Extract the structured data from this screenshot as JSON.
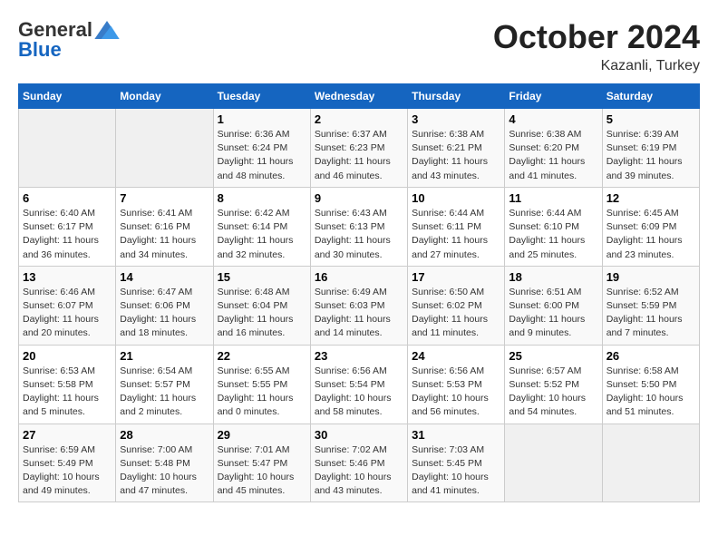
{
  "header": {
    "logo_general": "General",
    "logo_blue": "Blue",
    "month_title": "October 2024",
    "location": "Kazanli, Turkey"
  },
  "days_of_week": [
    "Sunday",
    "Monday",
    "Tuesday",
    "Wednesday",
    "Thursday",
    "Friday",
    "Saturday"
  ],
  "weeks": [
    [
      {
        "day": null
      },
      {
        "day": null
      },
      {
        "day": "1",
        "sunrise": "Sunrise: 6:36 AM",
        "sunset": "Sunset: 6:24 PM",
        "daylight": "Daylight: 11 hours and 48 minutes."
      },
      {
        "day": "2",
        "sunrise": "Sunrise: 6:37 AM",
        "sunset": "Sunset: 6:23 PM",
        "daylight": "Daylight: 11 hours and 46 minutes."
      },
      {
        "day": "3",
        "sunrise": "Sunrise: 6:38 AM",
        "sunset": "Sunset: 6:21 PM",
        "daylight": "Daylight: 11 hours and 43 minutes."
      },
      {
        "day": "4",
        "sunrise": "Sunrise: 6:38 AM",
        "sunset": "Sunset: 6:20 PM",
        "daylight": "Daylight: 11 hours and 41 minutes."
      },
      {
        "day": "5",
        "sunrise": "Sunrise: 6:39 AM",
        "sunset": "Sunset: 6:19 PM",
        "daylight": "Daylight: 11 hours and 39 minutes."
      }
    ],
    [
      {
        "day": "6",
        "sunrise": "Sunrise: 6:40 AM",
        "sunset": "Sunset: 6:17 PM",
        "daylight": "Daylight: 11 hours and 36 minutes."
      },
      {
        "day": "7",
        "sunrise": "Sunrise: 6:41 AM",
        "sunset": "Sunset: 6:16 PM",
        "daylight": "Daylight: 11 hours and 34 minutes."
      },
      {
        "day": "8",
        "sunrise": "Sunrise: 6:42 AM",
        "sunset": "Sunset: 6:14 PM",
        "daylight": "Daylight: 11 hours and 32 minutes."
      },
      {
        "day": "9",
        "sunrise": "Sunrise: 6:43 AM",
        "sunset": "Sunset: 6:13 PM",
        "daylight": "Daylight: 11 hours and 30 minutes."
      },
      {
        "day": "10",
        "sunrise": "Sunrise: 6:44 AM",
        "sunset": "Sunset: 6:11 PM",
        "daylight": "Daylight: 11 hours and 27 minutes."
      },
      {
        "day": "11",
        "sunrise": "Sunrise: 6:44 AM",
        "sunset": "Sunset: 6:10 PM",
        "daylight": "Daylight: 11 hours and 25 minutes."
      },
      {
        "day": "12",
        "sunrise": "Sunrise: 6:45 AM",
        "sunset": "Sunset: 6:09 PM",
        "daylight": "Daylight: 11 hours and 23 minutes."
      }
    ],
    [
      {
        "day": "13",
        "sunrise": "Sunrise: 6:46 AM",
        "sunset": "Sunset: 6:07 PM",
        "daylight": "Daylight: 11 hours and 20 minutes."
      },
      {
        "day": "14",
        "sunrise": "Sunrise: 6:47 AM",
        "sunset": "Sunset: 6:06 PM",
        "daylight": "Daylight: 11 hours and 18 minutes."
      },
      {
        "day": "15",
        "sunrise": "Sunrise: 6:48 AM",
        "sunset": "Sunset: 6:04 PM",
        "daylight": "Daylight: 11 hours and 16 minutes."
      },
      {
        "day": "16",
        "sunrise": "Sunrise: 6:49 AM",
        "sunset": "Sunset: 6:03 PM",
        "daylight": "Daylight: 11 hours and 14 minutes."
      },
      {
        "day": "17",
        "sunrise": "Sunrise: 6:50 AM",
        "sunset": "Sunset: 6:02 PM",
        "daylight": "Daylight: 11 hours and 11 minutes."
      },
      {
        "day": "18",
        "sunrise": "Sunrise: 6:51 AM",
        "sunset": "Sunset: 6:00 PM",
        "daylight": "Daylight: 11 hours and 9 minutes."
      },
      {
        "day": "19",
        "sunrise": "Sunrise: 6:52 AM",
        "sunset": "Sunset: 5:59 PM",
        "daylight": "Daylight: 11 hours and 7 minutes."
      }
    ],
    [
      {
        "day": "20",
        "sunrise": "Sunrise: 6:53 AM",
        "sunset": "Sunset: 5:58 PM",
        "daylight": "Daylight: 11 hours and 5 minutes."
      },
      {
        "day": "21",
        "sunrise": "Sunrise: 6:54 AM",
        "sunset": "Sunset: 5:57 PM",
        "daylight": "Daylight: 11 hours and 2 minutes."
      },
      {
        "day": "22",
        "sunrise": "Sunrise: 6:55 AM",
        "sunset": "Sunset: 5:55 PM",
        "daylight": "Daylight: 11 hours and 0 minutes."
      },
      {
        "day": "23",
        "sunrise": "Sunrise: 6:56 AM",
        "sunset": "Sunset: 5:54 PM",
        "daylight": "Daylight: 10 hours and 58 minutes."
      },
      {
        "day": "24",
        "sunrise": "Sunrise: 6:56 AM",
        "sunset": "Sunset: 5:53 PM",
        "daylight": "Daylight: 10 hours and 56 minutes."
      },
      {
        "day": "25",
        "sunrise": "Sunrise: 6:57 AM",
        "sunset": "Sunset: 5:52 PM",
        "daylight": "Daylight: 10 hours and 54 minutes."
      },
      {
        "day": "26",
        "sunrise": "Sunrise: 6:58 AM",
        "sunset": "Sunset: 5:50 PM",
        "daylight": "Daylight: 10 hours and 51 minutes."
      }
    ],
    [
      {
        "day": "27",
        "sunrise": "Sunrise: 6:59 AM",
        "sunset": "Sunset: 5:49 PM",
        "daylight": "Daylight: 10 hours and 49 minutes."
      },
      {
        "day": "28",
        "sunrise": "Sunrise: 7:00 AM",
        "sunset": "Sunset: 5:48 PM",
        "daylight": "Daylight: 10 hours and 47 minutes."
      },
      {
        "day": "29",
        "sunrise": "Sunrise: 7:01 AM",
        "sunset": "Sunset: 5:47 PM",
        "daylight": "Daylight: 10 hours and 45 minutes."
      },
      {
        "day": "30",
        "sunrise": "Sunrise: 7:02 AM",
        "sunset": "Sunset: 5:46 PM",
        "daylight": "Daylight: 10 hours and 43 minutes."
      },
      {
        "day": "31",
        "sunrise": "Sunrise: 7:03 AM",
        "sunset": "Sunset: 5:45 PM",
        "daylight": "Daylight: 10 hours and 41 minutes."
      },
      {
        "day": null
      },
      {
        "day": null
      }
    ]
  ]
}
